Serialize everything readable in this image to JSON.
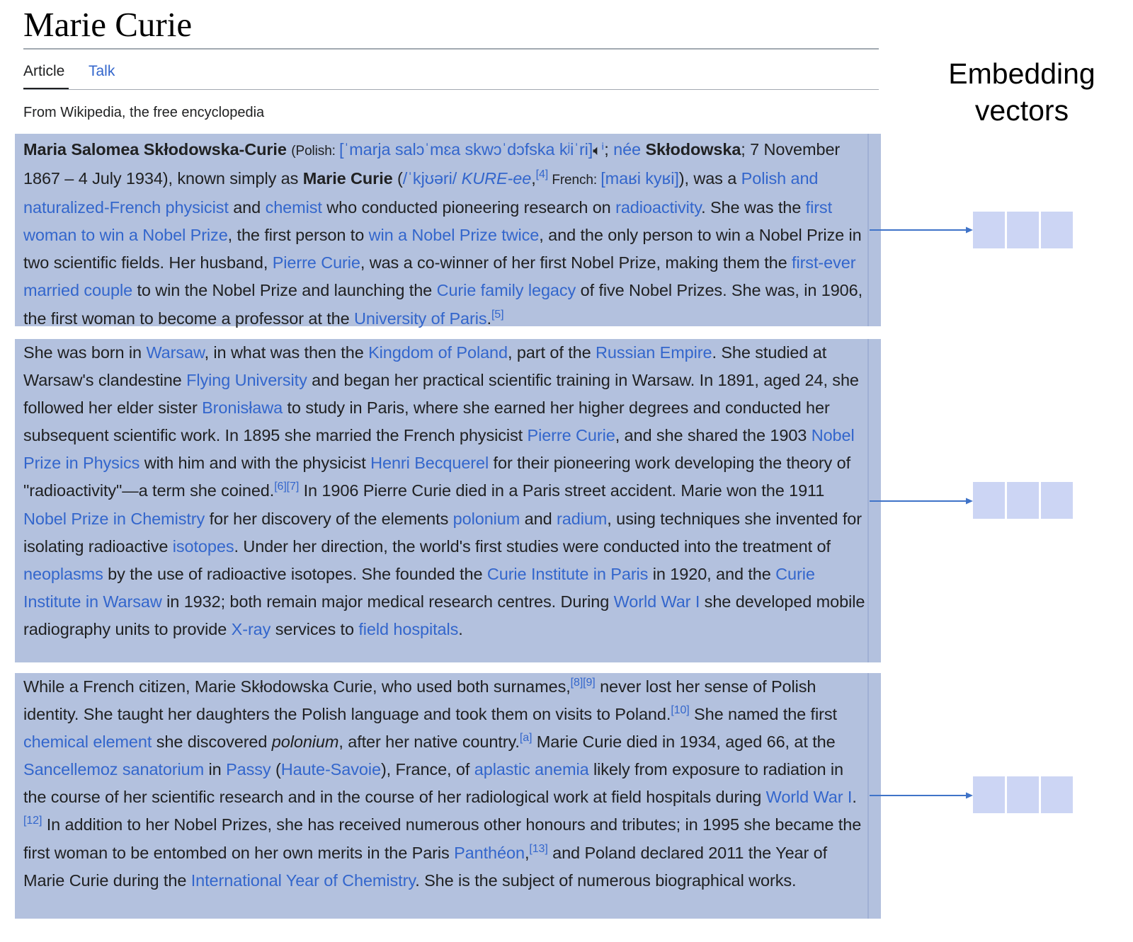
{
  "page": {
    "title": "Marie Curie",
    "tabs": [
      "Article",
      "Talk"
    ],
    "tagline": "From Wikipedia, the free encyclopedia"
  },
  "diagram": {
    "label_line1": "Embedding",
    "label_line2": "vectors",
    "colors": {
      "chunk": "#b3c1de",
      "link": "#3366cc",
      "arrow": "#3f73c8",
      "vector_cell": "#ccd5f4"
    },
    "vectors": [
      {
        "cells": 3
      },
      {
        "cells": 3
      },
      {
        "cells": 3
      }
    ]
  },
  "chunks": [
    [
      {
        "t": "Maria Salomea Skłodowska-Curie",
        "b": true
      },
      {
        "t": " "
      },
      {
        "t": "(Polish: ",
        "s": true
      },
      {
        "t": "[ˈmarja salɔˈmɛa skwɔˈdɔfska kʲiˈri]",
        "l": true
      },
      {
        "t": " 🔈︎",
        "icon": true
      },
      {
        "t": "ⁱ",
        "l": true
      },
      {
        "t": "; "
      },
      {
        "t": "née",
        "l": true
      },
      {
        "t": " "
      },
      {
        "t": "Skłodowska",
        "b": true
      },
      {
        "t": "; 7 November 1867 – 4 July 1934), known simply as "
      },
      {
        "t": "Marie Curie",
        "b": true
      },
      {
        "t": " ("
      },
      {
        "t": "/ˈkjʊəri/",
        "l": true
      },
      {
        "t": " "
      },
      {
        "t": "KURE-ee",
        "l": true,
        "i": true
      },
      {
        "t": ","
      },
      {
        "t": "[4]",
        "sup": true
      },
      {
        "t": " French: ",
        "s": true
      },
      {
        "t": "[maʁi kyʁi]",
        "l": true
      },
      {
        "t": "), was a "
      },
      {
        "t": "Polish and naturalized-French physicist",
        "l": true
      },
      {
        "t": " and "
      },
      {
        "t": "chemist",
        "l": true
      },
      {
        "t": " who conducted pioneering research on "
      },
      {
        "t": "radioactivity",
        "l": true
      },
      {
        "t": ". She was the "
      },
      {
        "t": "first woman to win a Nobel Prize",
        "l": true
      },
      {
        "t": ", the first person to "
      },
      {
        "t": "win a Nobel Prize twice",
        "l": true
      },
      {
        "t": ", and the only person to win a Nobel Prize in two scientific fields. Her husband, "
      },
      {
        "t": "Pierre Curie",
        "l": true
      },
      {
        "t": ", was a co-winner of her first Nobel Prize, making them the "
      },
      {
        "t": "first-ever married couple",
        "l": true
      },
      {
        "t": " to win the Nobel Prize and launching the "
      },
      {
        "t": "Curie family legacy",
        "l": true
      },
      {
        "t": " of five Nobel Prizes. She was, in 1906, the first woman to become a professor at the "
      },
      {
        "t": "University of Paris",
        "l": true
      },
      {
        "t": "."
      },
      {
        "t": "[5]",
        "sup": true
      }
    ],
    [
      {
        "t": "She was born in "
      },
      {
        "t": "Warsaw",
        "l": true
      },
      {
        "t": ", in what was then the "
      },
      {
        "t": "Kingdom of Poland",
        "l": true
      },
      {
        "t": ", part of the "
      },
      {
        "t": "Russian Empire",
        "l": true
      },
      {
        "t": ". She studied at Warsaw's clandestine "
      },
      {
        "t": "Flying University",
        "l": true
      },
      {
        "t": " and began her practical scientific training in Warsaw. In 1891, aged 24, she followed her elder sister "
      },
      {
        "t": "Bronisława",
        "l": true
      },
      {
        "t": " to study in Paris, where she earned her higher degrees and conducted her subsequent scientific work. In 1895 she married the French physicist "
      },
      {
        "t": "Pierre Curie",
        "l": true
      },
      {
        "t": ", and she shared the 1903 "
      },
      {
        "t": "Nobel Prize in Physics",
        "l": true
      },
      {
        "t": " with him and with the physicist "
      },
      {
        "t": "Henri Becquerel",
        "l": true
      },
      {
        "t": " for their pioneering work developing the theory of \"radioactivity\"—a term she coined."
      },
      {
        "t": "[6][7]",
        "sup": true
      },
      {
        "t": " In 1906 Pierre Curie died in a Paris street accident. Marie won the 1911 "
      },
      {
        "t": "Nobel Prize in Chemistry",
        "l": true
      },
      {
        "t": " for her discovery of the elements "
      },
      {
        "t": "polonium",
        "l": true
      },
      {
        "t": " and "
      },
      {
        "t": "radium",
        "l": true
      },
      {
        "t": ", using techniques she invented for isolating radioactive "
      },
      {
        "t": "isotopes",
        "l": true
      },
      {
        "t": ". Under her direction, the world's first studies were conducted into the treatment of "
      },
      {
        "t": "neoplasms",
        "l": true
      },
      {
        "t": " by the use of radioactive isotopes. She founded the "
      },
      {
        "t": "Curie Institute in Paris",
        "l": true
      },
      {
        "t": " in 1920, and the "
      },
      {
        "t": "Curie Institute in Warsaw",
        "l": true
      },
      {
        "t": " in 1932; both remain major medical research centres. During "
      },
      {
        "t": "World War I",
        "l": true
      },
      {
        "t": " she developed mobile radiography units to provide "
      },
      {
        "t": "X-ray",
        "l": true
      },
      {
        "t": " services to "
      },
      {
        "t": "field hospitals",
        "l": true
      },
      {
        "t": "."
      }
    ],
    [
      {
        "t": "While a French citizen, Marie Skłodowska Curie, who used both surnames,"
      },
      {
        "t": "[8][9]",
        "sup": true
      },
      {
        "t": " never lost her sense of Polish identity. She taught her daughters the Polish language and took them on visits to Poland."
      },
      {
        "t": "[10]",
        "sup": true
      },
      {
        "t": " She named the first "
      },
      {
        "t": "chemical element",
        "l": true
      },
      {
        "t": " she discovered "
      },
      {
        "t": "polonium",
        "i": true
      },
      {
        "t": ", after her native country."
      },
      {
        "t": "[a]",
        "sup": true
      },
      {
        "t": " Marie Curie died in 1934, aged 66, at the "
      },
      {
        "t": "Sancellemoz sanatorium",
        "l": true
      },
      {
        "t": " in "
      },
      {
        "t": "Passy",
        "l": true
      },
      {
        "t": " ("
      },
      {
        "t": "Haute-Savoie",
        "l": true
      },
      {
        "t": "), France, of "
      },
      {
        "t": "aplastic anemia",
        "l": true
      },
      {
        "t": " likely from exposure to radiation in the course of her scientific research and in the course of her radiological work at field hospitals during "
      },
      {
        "t": "World War I",
        "l": true
      },
      {
        "t": "."
      },
      {
        "t": "[12]",
        "sup": true
      },
      {
        "t": " In addition to her Nobel Prizes, she has received numerous other honours and tributes; in 1995 she became the first woman to be entombed on her own merits in the Paris "
      },
      {
        "t": "Panthéon",
        "l": true
      },
      {
        "t": ","
      },
      {
        "t": "[13]",
        "sup": true
      },
      {
        "t": " and Poland declared 2011 the Year of Marie Curie during the "
      },
      {
        "t": "International Year of Chemistry",
        "l": true
      },
      {
        "t": ". She is the subject of numerous biographical works."
      }
    ]
  ]
}
